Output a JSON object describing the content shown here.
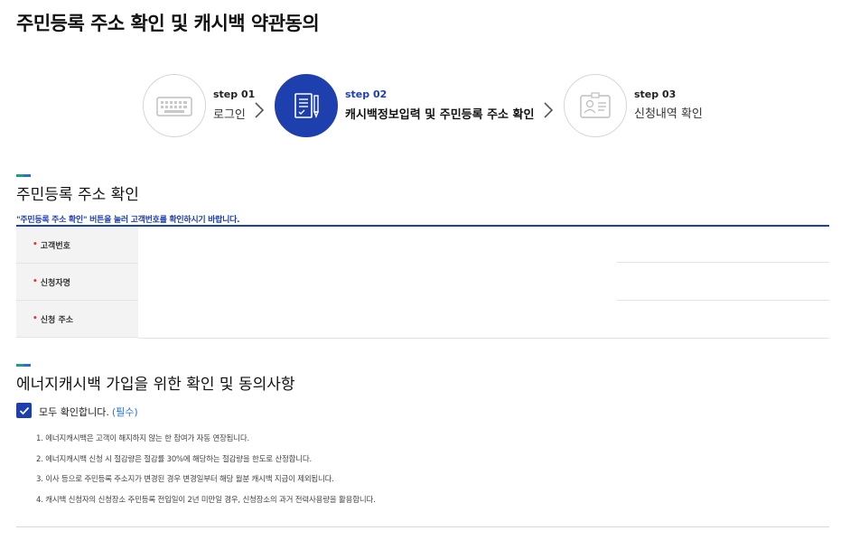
{
  "page": {
    "title": "주민등록 주소 확인 및 캐시백 약관동의"
  },
  "stepper": {
    "steps": [
      {
        "num": "step 01",
        "label": "로그인",
        "icon": "keyboard-icon",
        "active": false
      },
      {
        "num": "step 02",
        "label": "캐시백정보입력 및 주민등록 주소 확인",
        "icon": "document-pencil-icon",
        "active": true
      },
      {
        "num": "step 03",
        "label": "신청내역 확인",
        "icon": "id-card-icon",
        "active": false
      }
    ],
    "active_color": "#1e3fae"
  },
  "address_section": {
    "title": "주민등록 주소 확인",
    "notice": "\"주민등록 주소 확인\" 버튼을 눌러 고객번호를 확인하시기 바랍니다.",
    "rows": [
      {
        "label": "고객번호",
        "value": ""
      },
      {
        "label": "신청자명",
        "value": ""
      },
      {
        "label": "신청 주소",
        "value": ""
      }
    ]
  },
  "consent_section": {
    "title": "에너지캐시백 가입을 위한 확인 및 동의사항",
    "check_all_label": "모두 확인합니다.",
    "check_all_required": "(필수)",
    "checked": true,
    "terms": [
      "1. 에너지캐시백은 고객이 해지하지 않는 한 참여가 자동 연장됩니다.",
      "2. 에너지캐시백 신청 시 절감량은 절감률 30%에 해당하는 절감량을 한도로 산정합니다.",
      "3. 이사 등으로 주민등록 주소지가 변경된 경우 변경일부터 해당 월분 캐시백 지급이 제외됩니다.",
      "4. 캐시백 신청자의 신청장소 주민등록 전입일이 2년 미만일 경우, 신청장소의 과거 전력사용량을 활용합니다."
    ]
  }
}
